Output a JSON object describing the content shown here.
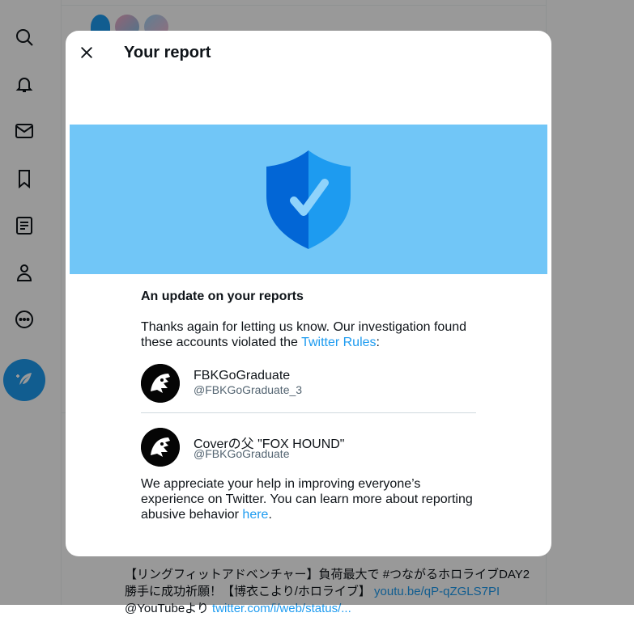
{
  "background": {
    "nav_icons": [
      "search-icon",
      "bell-icon",
      "mail-icon",
      "bookmark-icon",
      "list-icon",
      "profile-icon",
      "more-icon"
    ],
    "compose_icon": "compose-feather-icon",
    "tweet_lines": [
      "【リングフィットアドベンチャー】負荷最大で #つながるホロライブDAY2",
      "勝手に成功祈願！【博衣こより/ホロライブ】",
      "@YouTubeより"
    ],
    "tweet_link": "youtu.be/qP-qZGLS7PI",
    "tweet_link2": "twitter.com/i/web/status/..."
  },
  "modal": {
    "title": "Your report",
    "close_icon": "close-icon",
    "banner_icon": "shield-check-icon",
    "heading": "An update on your reports",
    "intro_text": "Thanks again for letting us know. Our investigation found these accounts violated the ",
    "rules_link": "Twitter Rules",
    "intro_end": ":",
    "accounts": [
      {
        "name": "FBKGoGraduate",
        "handle": "@FBKGoGraduate_3"
      },
      {
        "name": "Coverの父 \"FOX HOUND\"",
        "handle": "@FBKGoGraduate"
      }
    ],
    "outro_text": "We appreciate your help in improving everyone’s experience on Twitter. You can learn more about reporting abusive behavior ",
    "here_link": "here",
    "outro_end": "."
  },
  "colors": {
    "accent": "#1d9bf0",
    "banner": "#71c6f7",
    "shield_dark": "#0266d6",
    "shield_light": "#1d9bf0"
  }
}
